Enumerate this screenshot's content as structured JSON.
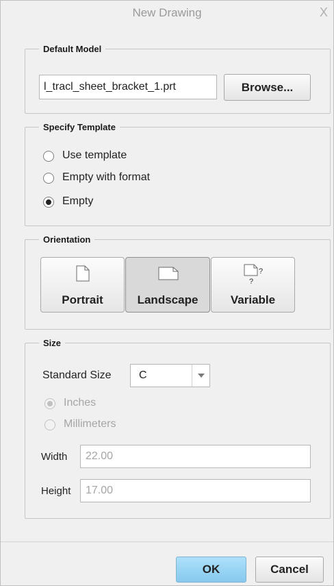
{
  "window": {
    "title": "New Drawing",
    "close_glyph": "X"
  },
  "default_model": {
    "legend": "Default Model",
    "value": "l_tracl_sheet_bracket_1.prt",
    "browse_label": "Browse..."
  },
  "template": {
    "legend": "Specify Template",
    "options": [
      {
        "label": "Use template",
        "checked": false
      },
      {
        "label": "Empty with format",
        "checked": false
      },
      {
        "label": "Empty",
        "checked": true
      }
    ]
  },
  "orientation": {
    "legend": "Orientation",
    "buttons": [
      {
        "label": "Portrait",
        "icon": "portrait-page-icon",
        "active": false
      },
      {
        "label": "Landscape",
        "icon": "landscape-page-icon",
        "active": true
      },
      {
        "label": "Variable",
        "icon": "variable-page-icon",
        "active": false
      }
    ]
  },
  "size": {
    "legend": "Size",
    "standard_size_label": "Standard Size",
    "standard_size_value": "C",
    "units": [
      {
        "label": "Inches",
        "checked": true,
        "enabled": false
      },
      {
        "label": "Millimeters",
        "checked": false,
        "enabled": false
      }
    ],
    "width_label": "Width",
    "width_value": "22.00",
    "height_label": "Height",
    "height_value": "17.00"
  },
  "footer": {
    "ok_label": "OK",
    "cancel_label": "Cancel"
  },
  "colors": {
    "ok_button": "#8fd0f2",
    "dialog_bg": "#f0f0f0"
  }
}
